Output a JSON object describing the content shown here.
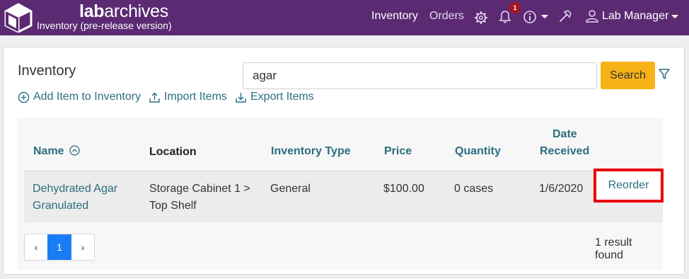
{
  "header": {
    "brand_bold": "lab",
    "brand_rest": "archives",
    "subtitle": "Inventory (pre-release version)",
    "nav_inventory": "Inventory",
    "nav_orders": "Orders",
    "notification_count": "1",
    "user_label": "Lab Manager",
    "icons": [
      "gear-icon",
      "bell-icon",
      "info-icon",
      "tools-icon",
      "user-icon"
    ],
    "colors": {
      "bar": "#5b2a73"
    }
  },
  "main": {
    "title": "Inventory",
    "search": {
      "value": "agar",
      "button_label": "Search"
    },
    "actions": {
      "add_item": "Add Item to Inventory",
      "import_items": "Import Items",
      "export_items": "Export Items"
    },
    "table": {
      "columns": {
        "name": "Name",
        "location": "Location",
        "inventory_type": "Inventory Type",
        "price": "Price",
        "quantity": "Quantity",
        "date_line1": "Date",
        "date_line2": "Received"
      },
      "rows": [
        {
          "name_line1": "Dehydrated Agar",
          "name_line2": "Granulated",
          "location_line1": "Storage Cabinet 1 >",
          "location_line2": "Top Shelf",
          "inventory_type": "General",
          "price": "$100.00",
          "quantity": "0 cases",
          "date_received": "1/6/2020",
          "action": "Reorder"
        }
      ]
    },
    "pagination": {
      "prev": "‹",
      "current": "1",
      "next": "›"
    },
    "result_count": "1 result found",
    "colors": {
      "accent": "#2c6e80",
      "search_button": "#f7b217",
      "highlight": "#e8000b",
      "active_page": "#1a7cf5"
    }
  }
}
